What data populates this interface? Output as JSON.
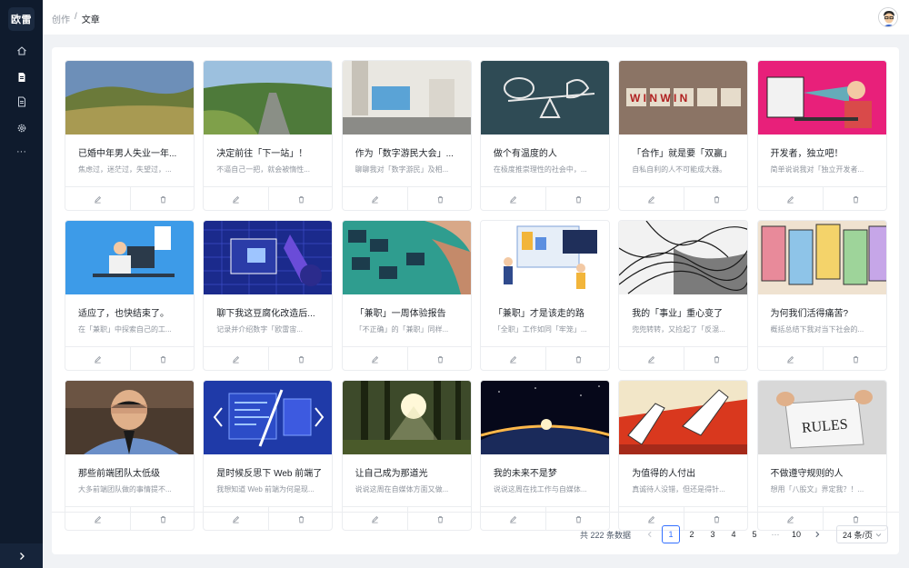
{
  "brand": {
    "logo_text": "欧雷"
  },
  "sidebar": {
    "items": [
      {
        "name": "home-icon"
      },
      {
        "name": "document-icon"
      },
      {
        "name": "file-icon"
      },
      {
        "name": "settings-icon"
      },
      {
        "name": "more-icon",
        "text": "···"
      }
    ],
    "expand_icon": "chevron-right-icon"
  },
  "breadcrumb": {
    "parent": "创作",
    "separator": "/",
    "current": "文章"
  },
  "articles": [
    {
      "title": "已婚中年男人失业一年...",
      "desc": "焦虑过，迷茫过，失望过，..."
    },
    {
      "title": "决定前往「下一站」！",
      "desc": "不逼自己一把，就会被惰性..."
    },
    {
      "title": "作为「数字游民大会」...",
      "desc": "聊聊我对「数字游民」及相..."
    },
    {
      "title": "做个有温度的人",
      "desc": "在极度推崇理性的社会中，..."
    },
    {
      "title": "「合作」就是要「双赢」",
      "desc": "自私自利的人不可能成大器。"
    },
    {
      "title": "开发者，独立吧！",
      "desc": "简单说说我对「独立开发者..."
    },
    {
      "title": "适应了，也快结束了。",
      "desc": "在「兼职」中探索自己的工..."
    },
    {
      "title": "聊下我这豆腐化改造后...",
      "desc": "记录并介绍数字「欧雷宙..."
    },
    {
      "title": "「兼职」一周体验报告",
      "desc": "「不正确」的「兼职」同样..."
    },
    {
      "title": "「兼职」才是该走的路",
      "desc": "「全职」工作如同「牢笼」..."
    },
    {
      "title": "我的「事业」重心变了",
      "desc": "兜兜转转，又捡起了「反混..."
    },
    {
      "title": "为何我们活得痛苦?",
      "desc": "概括总结下我对当下社会的..."
    },
    {
      "title": "那些前端团队太低级",
      "desc": "大多前端团队做的事情提不..."
    },
    {
      "title": "是时候反思下 Web 前端了",
      "desc": "我想知道 Web 前端为何是现..."
    },
    {
      "title": "让自己成为那道光",
      "desc": "说说这周在自媒体方面又做..."
    },
    {
      "title": "我的未来不是梦",
      "desc": "说说这周在找工作与自媒体..."
    },
    {
      "title": "为值得的人付出",
      "desc": "真诚待人没错，但还是得针..."
    },
    {
      "title": "不做遵守规则的人",
      "desc": "想用「八股文」界定我？！..."
    }
  ],
  "pagination": {
    "total_text": "共 222 条数据",
    "prev_icon": "chevron-left-icon",
    "pages": [
      "1",
      "2",
      "3",
      "4",
      "5"
    ],
    "ellipsis": "···",
    "last": "10",
    "next_icon": "chevron-right-icon",
    "current": "1",
    "page_size": "24 条/页"
  },
  "colors": {
    "sidebar": "#0f1b2d",
    "accent": "#3370ff",
    "panel": "#ffffff",
    "background": "#f0f2f5"
  }
}
